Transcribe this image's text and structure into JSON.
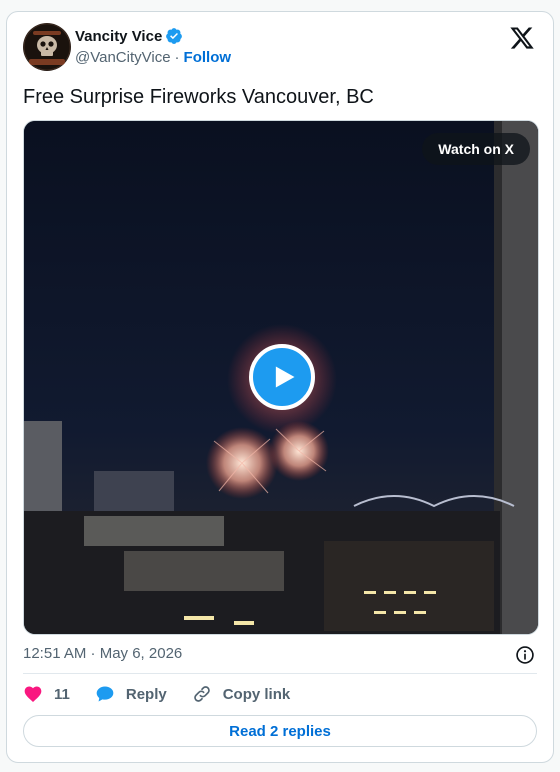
{
  "author": {
    "name": "Vancity Vice",
    "handle": "@VanCityVice",
    "separator": "·",
    "follow_label": "Follow"
  },
  "tweet": {
    "text": "Free Surprise Fireworks Vancouver, BC",
    "timestamp": "12:51 AM · May 6, 2026"
  },
  "media": {
    "watch_label": "Watch on X"
  },
  "actions": {
    "like_count": "11",
    "reply_label": "Reply",
    "copy_link_label": "Copy link"
  },
  "footer": {
    "read_replies_label": "Read 2 replies"
  },
  "colors": {
    "accent": "#1d9bf0",
    "link": "#006fd6",
    "like": "#f91880",
    "text_secondary": "#536471"
  },
  "icons": [
    "verified-badge-icon",
    "x-logo-icon",
    "play-icon",
    "info-icon",
    "heart-icon",
    "reply-bubble-icon",
    "link-icon"
  ]
}
